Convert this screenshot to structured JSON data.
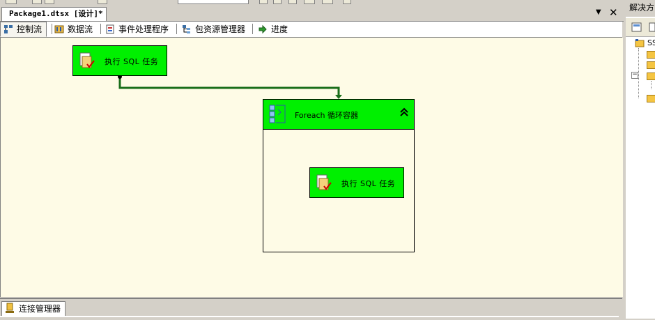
{
  "document_tab": {
    "title": "Package1.dtsx [设计]*"
  },
  "designer_tabs": [
    {
      "label": "控制流",
      "icon": "control-flow-icon"
    },
    {
      "label": "数据流",
      "icon": "data-flow-icon"
    },
    {
      "label": "事件处理程序",
      "icon": "event-handler-icon"
    },
    {
      "label": "包资源管理器",
      "icon": "package-explorer-icon"
    },
    {
      "label": "进度",
      "icon": "progress-icon"
    }
  ],
  "canvas": {
    "task1": {
      "label": "执行 SQL 任务",
      "icon": "execute-sql-task-icon"
    },
    "foreach": {
      "label": "Foreach 循环容器",
      "icon": "foreach-loop-icon",
      "collapse_glyph": "⌃"
    },
    "task2": {
      "label": "执行 SQL 任务",
      "icon": "execute-sql-task-icon"
    }
  },
  "bottom": {
    "connection_manager_tab": "连接管理器"
  },
  "right_pane": {
    "title": "解决方",
    "tree_root": "SS"
  },
  "colors": {
    "task_fill": "#00f000",
    "canvas_bg": "#fefbe6",
    "connector": "#1a6e1a"
  }
}
